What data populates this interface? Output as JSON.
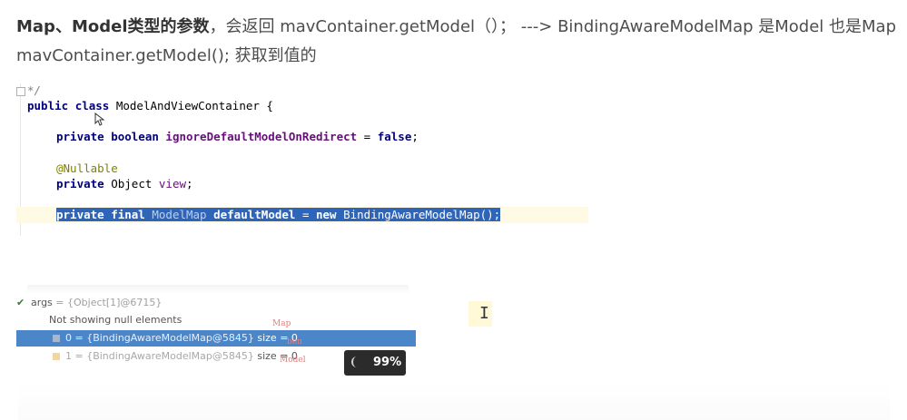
{
  "article": {
    "line1_bold": "Map、Model类型的参数",
    "line1_rest": "，会返回 mavContainer.getModel（）；  ---> BindingAwareModelMap 是Model 也是Map",
    "line2": "mavContainer.getModel(); 获取到值的"
  },
  "code": {
    "comment_line": "*/",
    "class_kw1": "public",
    "class_kw2": "class",
    "class_name": "ModelAndViewContainer {",
    "field1_mod": "private boolean",
    "field1_name": "ignoreDefaultModelOnRedirect",
    "field1_eq": " = ",
    "field1_val": "false",
    "field1_end": ";",
    "annotation": "@Nullable",
    "field2_mod": "private",
    "field2_type": " Object ",
    "field2_name": "view",
    "field2_end": ";",
    "field3_mod": "private final",
    "field3_type": " ModelMap ",
    "field3_name": "defaultModel",
    "field3_eq": " = ",
    "field3_new": "new",
    "field3_rest": " BindingAwareModelMap();"
  },
  "debugger": {
    "args_label": "args",
    "args_value": " = {Object[1]@6715}",
    "null_note": "Not showing null elements",
    "items": [
      {
        "text": "0 = {BindingAwareModelMap@5845}",
        "size": "  size = 0"
      },
      {
        "text": "1 = {BindingAwareModelMap@5845}",
        "size": "  size = 0"
      }
    ]
  },
  "handwriting": {
    "map": "Map",
    "ben": "ben",
    "model": "Model"
  },
  "progress": {
    "percent_label": "99%",
    "value": 0.99
  }
}
